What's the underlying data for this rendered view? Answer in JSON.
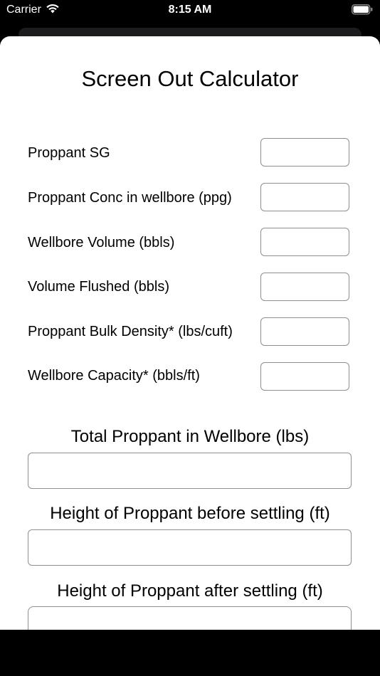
{
  "status_bar": {
    "carrier": "Carrier",
    "time": "8:15 AM"
  },
  "title": "Screen Out Calculator",
  "inputs": [
    {
      "label": "Proppant SG",
      "value": ""
    },
    {
      "label": "Proppant Conc in wellbore (ppg)",
      "value": ""
    },
    {
      "label": "Wellbore Volume (bbls)",
      "value": ""
    },
    {
      "label": "Volume Flushed (bbls)",
      "value": ""
    },
    {
      "label": "Proppant Bulk Density* (lbs/cuft)",
      "value": ""
    },
    {
      "label": "Wellbore Capacity* (bbls/ft)",
      "value": ""
    }
  ],
  "outputs": [
    {
      "label": "Total Proppant in Wellbore (lbs)",
      "value": ""
    },
    {
      "label": "Height of Proppant before settling (ft)",
      "value": ""
    },
    {
      "label": "Height of Proppant after settling (ft)",
      "value": ""
    }
  ],
  "icons": {
    "wifi": "wifi-icon",
    "battery": "battery-icon"
  }
}
